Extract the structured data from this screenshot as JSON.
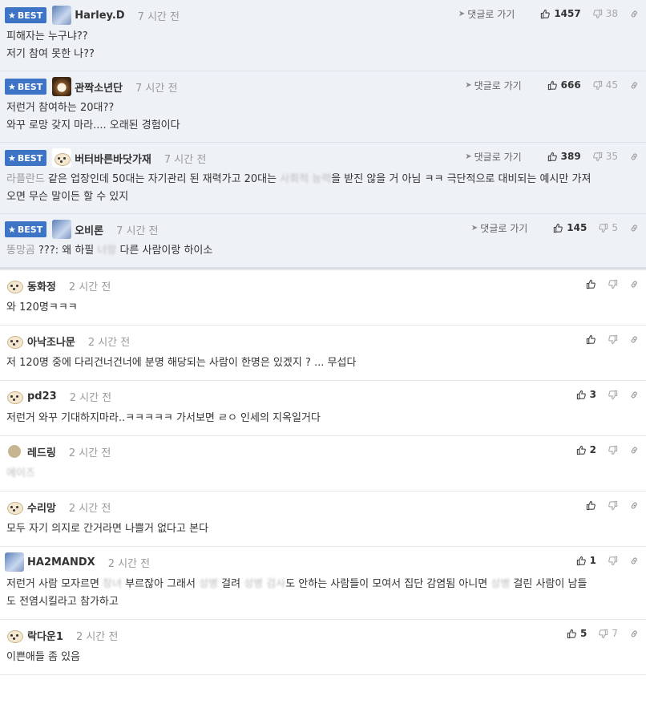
{
  "best_label": "BEST",
  "goto_label": "댓글로 가기",
  "best_comments": [
    {
      "nick": "Harley.D",
      "time": "7 시간 전",
      "up": "1457",
      "down": "38",
      "avatar": "blue",
      "lines": [
        [
          {
            "t": "피해자는 누구냐??"
          }
        ],
        [
          {
            "t": "저기 참여 못한 나??"
          }
        ]
      ]
    },
    {
      "nick": "관짝소년단",
      "time": "7 시간 전",
      "up": "666",
      "down": "45",
      "avatar": "fur",
      "lines": [
        [
          {
            "t": "저런거 참여하는 20대??"
          }
        ],
        [
          {
            "t": "와꾸 로망 갖지 마라.... 오래된 경험이다"
          }
        ]
      ]
    },
    {
      "nick": "버터바른바닷가재",
      "time": "7 시간 전",
      "up": "389",
      "down": "35",
      "avatar": "dog",
      "lines": [
        [
          {
            "t": "라플란드",
            "c": "muted"
          },
          {
            "t": " 같은 업장인데 50대는 자기관리 된 재력가고 20대는 "
          },
          {
            "t": "사회적 능력",
            "c": "blur"
          },
          {
            "t": "을 받진 않을 거 아님 ㅋㅋ 극단적으로 대비되는 예시만 가져"
          }
        ],
        [
          {
            "t": "오면 무슨 말이든 할 수 있지"
          }
        ]
      ]
    },
    {
      "nick": "오비론",
      "time": "7 시간 전",
      "up": "145",
      "down": "5",
      "avatar": "blue",
      "lines": [
        [
          {
            "t": "똥망곰",
            "c": "muted"
          },
          {
            "t": " ???: 왜 하필 "
          },
          {
            "t": "너랑",
            "c": "blur"
          },
          {
            "t": " 다른 사람이랑 하이소"
          }
        ]
      ]
    }
  ],
  "comments": [
    {
      "nick": "동화정",
      "time": "2 시간 전",
      "up": "",
      "down": "",
      "avatar": "dog",
      "lines": [
        [
          {
            "t": "와 120명ㅋㅋㅋ"
          }
        ]
      ]
    },
    {
      "nick": "아낙조나문",
      "time": "2 시간 전",
      "up": "",
      "down": "",
      "avatar": "dog",
      "lines": [
        [
          {
            "t": "저 120명 중에 다리건너건너에 분명 해당되는 사람이 한명은 있겠지 ? ... 무섭다"
          }
        ]
      ]
    },
    {
      "nick": "pd23",
      "time": "2 시간 전",
      "up": "3",
      "down": "",
      "avatar": "dog",
      "lines": [
        [
          {
            "t": "저런거 와꾸 기대하지마라..ㅋㅋㅋㅋㅋ 가서보면 ㄹㅇ 인세의 지옥일거다"
          }
        ]
      ]
    },
    {
      "nick": "레드링",
      "time": "2 시간 전",
      "up": "2",
      "down": "",
      "avatar": "round",
      "lines": [
        [
          {
            "t": "에이즈",
            "c": "blur"
          }
        ]
      ]
    },
    {
      "nick": "수리망",
      "time": "2 시간 전",
      "up": "",
      "down": "",
      "avatar": "dog",
      "lines": [
        [
          {
            "t": "모두 자기 의지로 간거라면 나쁠거 없다고 본다"
          }
        ]
      ]
    },
    {
      "nick": "HA2MANDX",
      "time": "2 시간 전",
      "up": "1",
      "down": "",
      "avatar": "blue",
      "lines": [
        [
          {
            "t": "저런거 사람 모자르면 "
          },
          {
            "t": "창녀",
            "c": "blur"
          },
          {
            "t": " 부르잖아 그래서 "
          },
          {
            "t": "성병",
            "c": "blur"
          },
          {
            "t": " 걸려 "
          },
          {
            "t": "성병",
            "c": "blur"
          },
          {
            "t": " "
          },
          {
            "t": "검사",
            "c": "blur"
          },
          {
            "t": "도 안하는 사람들이 모여서 집단 감염됨 아니면 "
          },
          {
            "t": "성병",
            "c": "blur"
          },
          {
            "t": " 걸린 사람이 남들"
          }
        ],
        [
          {
            "t": "도 전염시킬라고 참가하고"
          }
        ]
      ]
    },
    {
      "nick": "락다운1",
      "time": "2 시간 전",
      "up": "5",
      "down": "7",
      "avatar": "dog",
      "lines": [
        [
          {
            "t": "이쁜애들 좀 있음"
          }
        ]
      ]
    }
  ]
}
